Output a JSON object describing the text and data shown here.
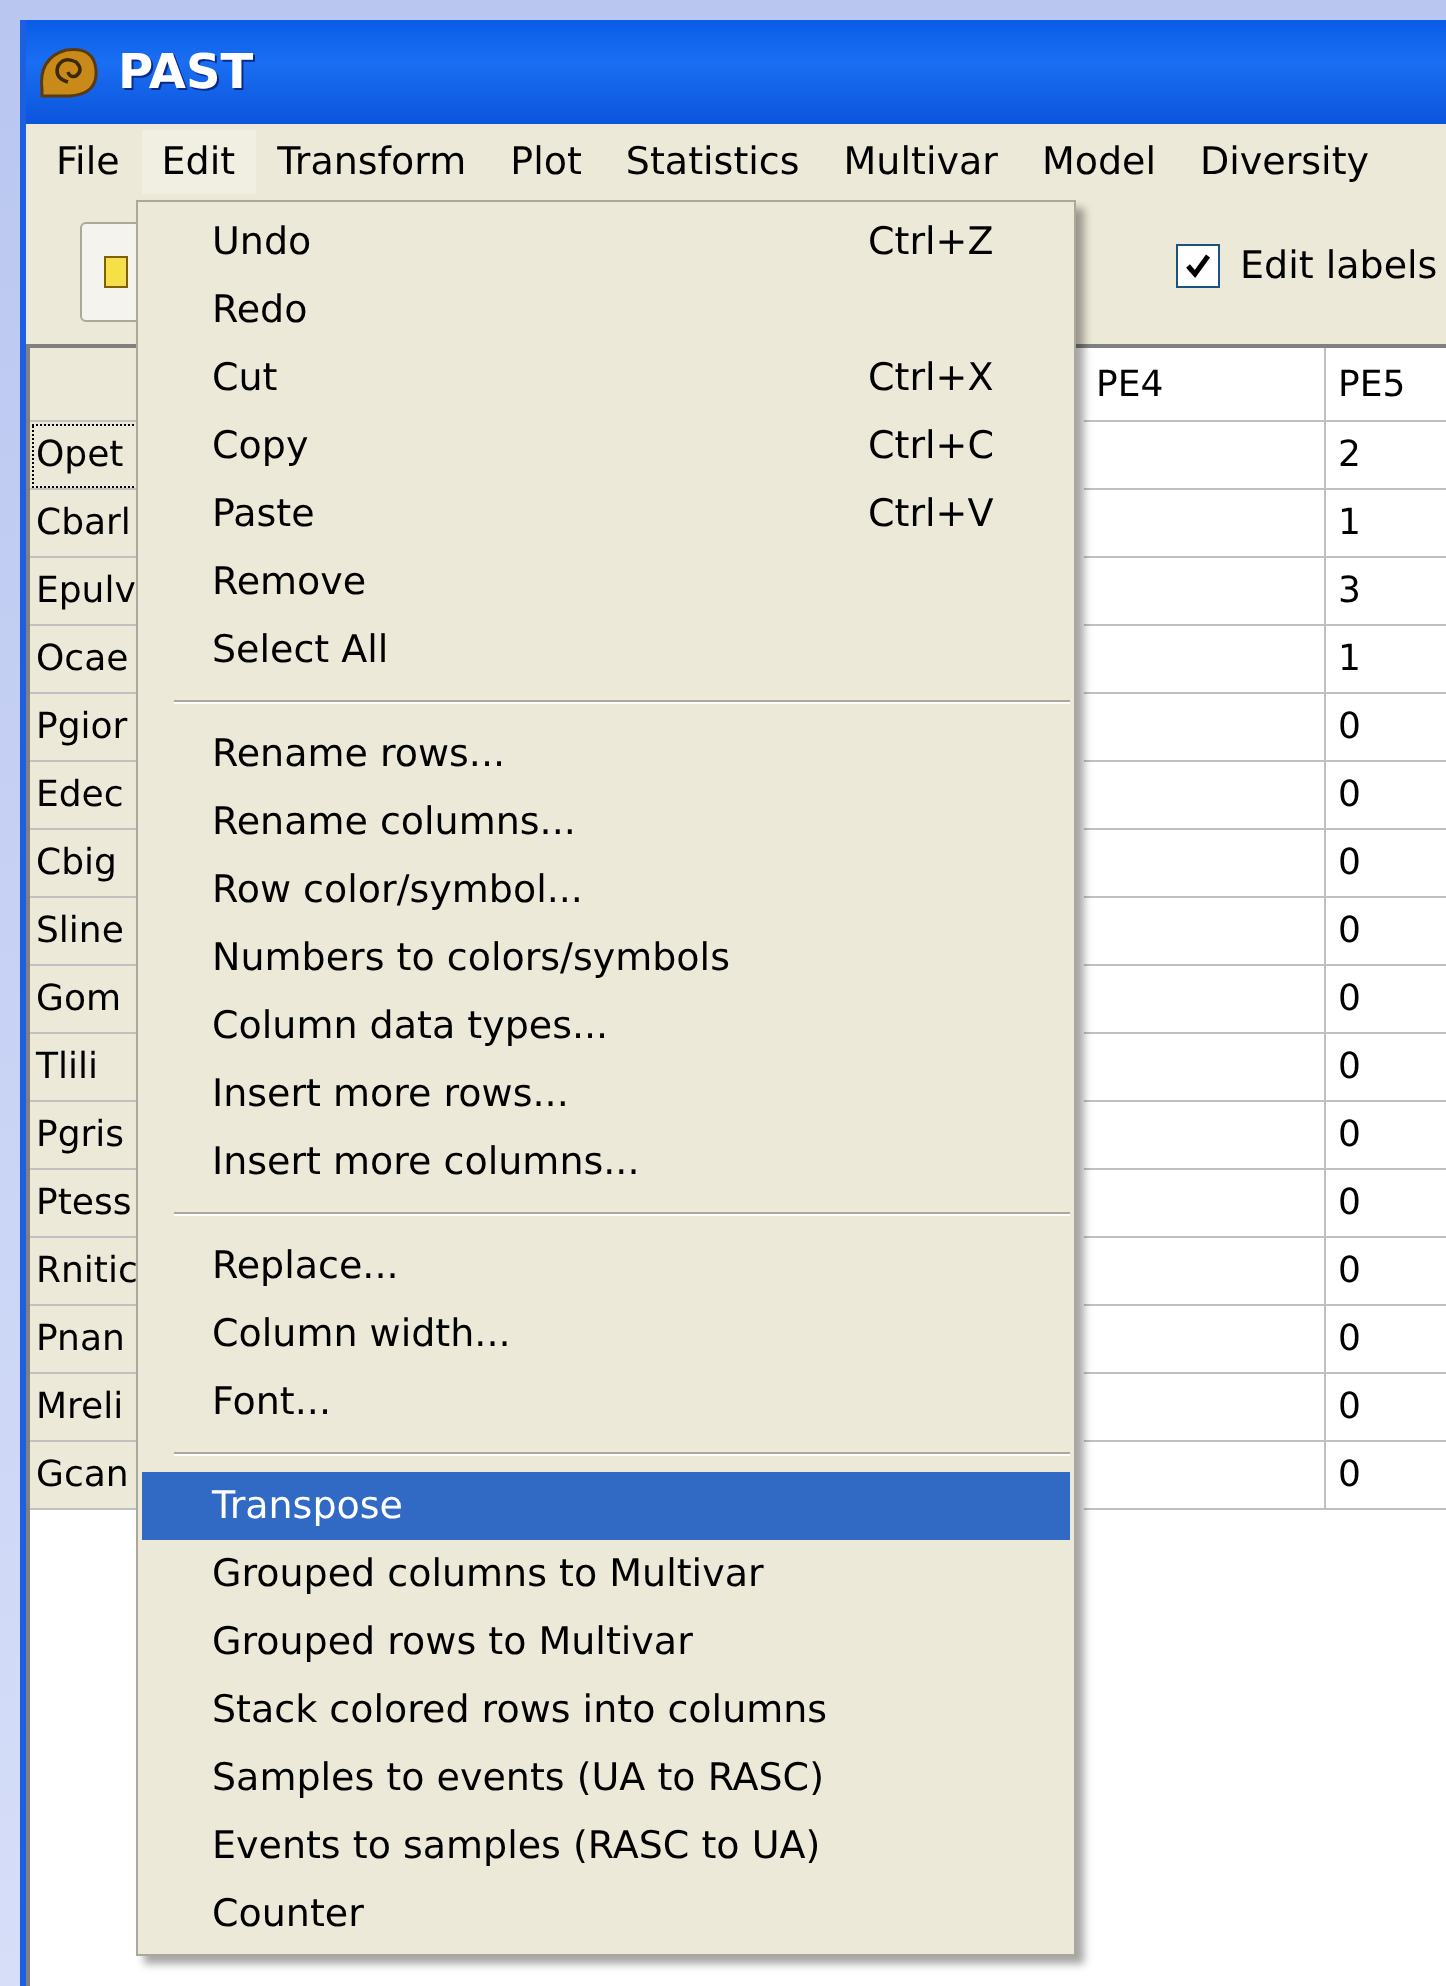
{
  "window": {
    "title": "PAST"
  },
  "menu_bar": [
    {
      "label": "File",
      "selected": false
    },
    {
      "label": "Edit",
      "selected": true
    },
    {
      "label": "Transform",
      "selected": false
    },
    {
      "label": "Plot",
      "selected": false
    },
    {
      "label": "Statistics",
      "selected": false
    },
    {
      "label": "Multivar",
      "selected": false
    },
    {
      "label": "Model",
      "selected": false
    },
    {
      "label": "Diversity",
      "selected": false
    }
  ],
  "toolbar": {
    "edit_labels": {
      "label": "Edit labels",
      "checked": true
    }
  },
  "table": {
    "columns": [
      "PE4",
      "PE5"
    ],
    "rows": [
      {
        "label": "Opet",
        "pe5": "2",
        "focused": true
      },
      {
        "label": "Cbarl",
        "pe5": "1",
        "focused": false
      },
      {
        "label": "Epulv",
        "pe5": "3",
        "focused": false
      },
      {
        "label": "Ocae",
        "pe5": "1",
        "focused": false
      },
      {
        "label": "Pgior",
        "pe5": "0",
        "focused": false
      },
      {
        "label": "Edec",
        "pe5": "0",
        "focused": false
      },
      {
        "label": "Cbig",
        "pe5": "0",
        "focused": false
      },
      {
        "label": "Sline",
        "pe5": "0",
        "focused": false
      },
      {
        "label": "Gom",
        "pe5": "0",
        "focused": false
      },
      {
        "label": "Tlili",
        "pe5": "0",
        "focused": false
      },
      {
        "label": "Pgris",
        "pe5": "0",
        "focused": false
      },
      {
        "label": "Ptess",
        "pe5": "0",
        "focused": false
      },
      {
        "label": "Rnitic",
        "pe5": "0",
        "focused": false
      },
      {
        "label": "Pnan",
        "pe5": "0",
        "focused": false
      },
      {
        "label": "Mreli",
        "pe5": "0",
        "focused": false
      },
      {
        "label": "Gcan",
        "pe5": "0",
        "focused": false
      }
    ]
  },
  "edit_menu": {
    "groups": [
      [
        {
          "label": "Undo",
          "shortcut": "Ctrl+Z",
          "selected": false
        },
        {
          "label": "Redo",
          "selected": false
        },
        {
          "label": "Cut",
          "shortcut": "Ctrl+X",
          "selected": false
        },
        {
          "label": "Copy",
          "shortcut": "Ctrl+C",
          "selected": false
        },
        {
          "label": "Paste",
          "shortcut": "Ctrl+V",
          "selected": false
        },
        {
          "label": "Remove",
          "selected": false
        },
        {
          "label": "Select All",
          "selected": false
        }
      ],
      [
        {
          "label": "Rename rows...",
          "selected": false
        },
        {
          "label": "Rename columns...",
          "selected": false
        },
        {
          "label": "Row color/symbol...",
          "selected": false
        },
        {
          "label": "Numbers to colors/symbols",
          "selected": false
        },
        {
          "label": "Column data types...",
          "selected": false
        },
        {
          "label": "Insert more rows...",
          "selected": false
        },
        {
          "label": "Insert more columns...",
          "selected": false
        }
      ],
      [
        {
          "label": "Replace...",
          "selected": false
        },
        {
          "label": "Column width...",
          "selected": false
        },
        {
          "label": "Font...",
          "selected": false
        }
      ],
      [
        {
          "label": "Transpose",
          "selected": true
        },
        {
          "label": "Grouped columns to Multivar",
          "selected": false
        },
        {
          "label": "Grouped rows to Multivar",
          "selected": false
        },
        {
          "label": "Stack colored rows into columns",
          "selected": false
        },
        {
          "label": "Samples to events (UA to RASC)",
          "selected": false
        },
        {
          "label": "Events to samples (RASC to UA)",
          "selected": false
        },
        {
          "label": "Counter",
          "selected": false
        }
      ]
    ]
  }
}
